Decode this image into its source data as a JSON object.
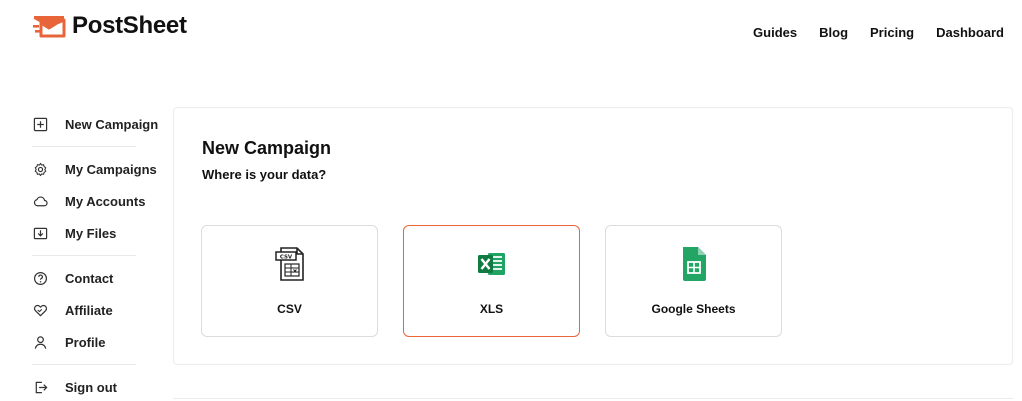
{
  "brand": {
    "name": "PostSheet",
    "logo_icon": "envelope-logo-icon",
    "accent": "#e8653a"
  },
  "nav": [
    {
      "label": "Guides"
    },
    {
      "label": "Blog"
    },
    {
      "label": "Pricing"
    },
    {
      "label": "Dashboard"
    }
  ],
  "sidebar": {
    "items": [
      {
        "label": "New Campaign",
        "icon": "plus-square-icon"
      },
      {
        "label": "My Campaigns",
        "icon": "gear-icon"
      },
      {
        "label": "My Accounts",
        "icon": "cloud-icon"
      },
      {
        "label": "My Files",
        "icon": "download-box-icon"
      },
      {
        "label": "Contact",
        "icon": "question-circle-icon"
      },
      {
        "label": "Affiliate",
        "icon": "heart-handshake-icon"
      },
      {
        "label": "Profile",
        "icon": "user-icon"
      },
      {
        "label": "Sign out",
        "icon": "sign-out-icon"
      }
    ]
  },
  "main": {
    "title": "New Campaign",
    "subtitle": "Where is your data?",
    "sources": [
      {
        "label": "CSV",
        "icon": "csv-file-icon",
        "selected": false
      },
      {
        "label": "XLS",
        "icon": "excel-icon",
        "selected": true
      },
      {
        "label": "Google Sheets",
        "icon": "google-sheets-icon",
        "selected": false
      }
    ]
  }
}
